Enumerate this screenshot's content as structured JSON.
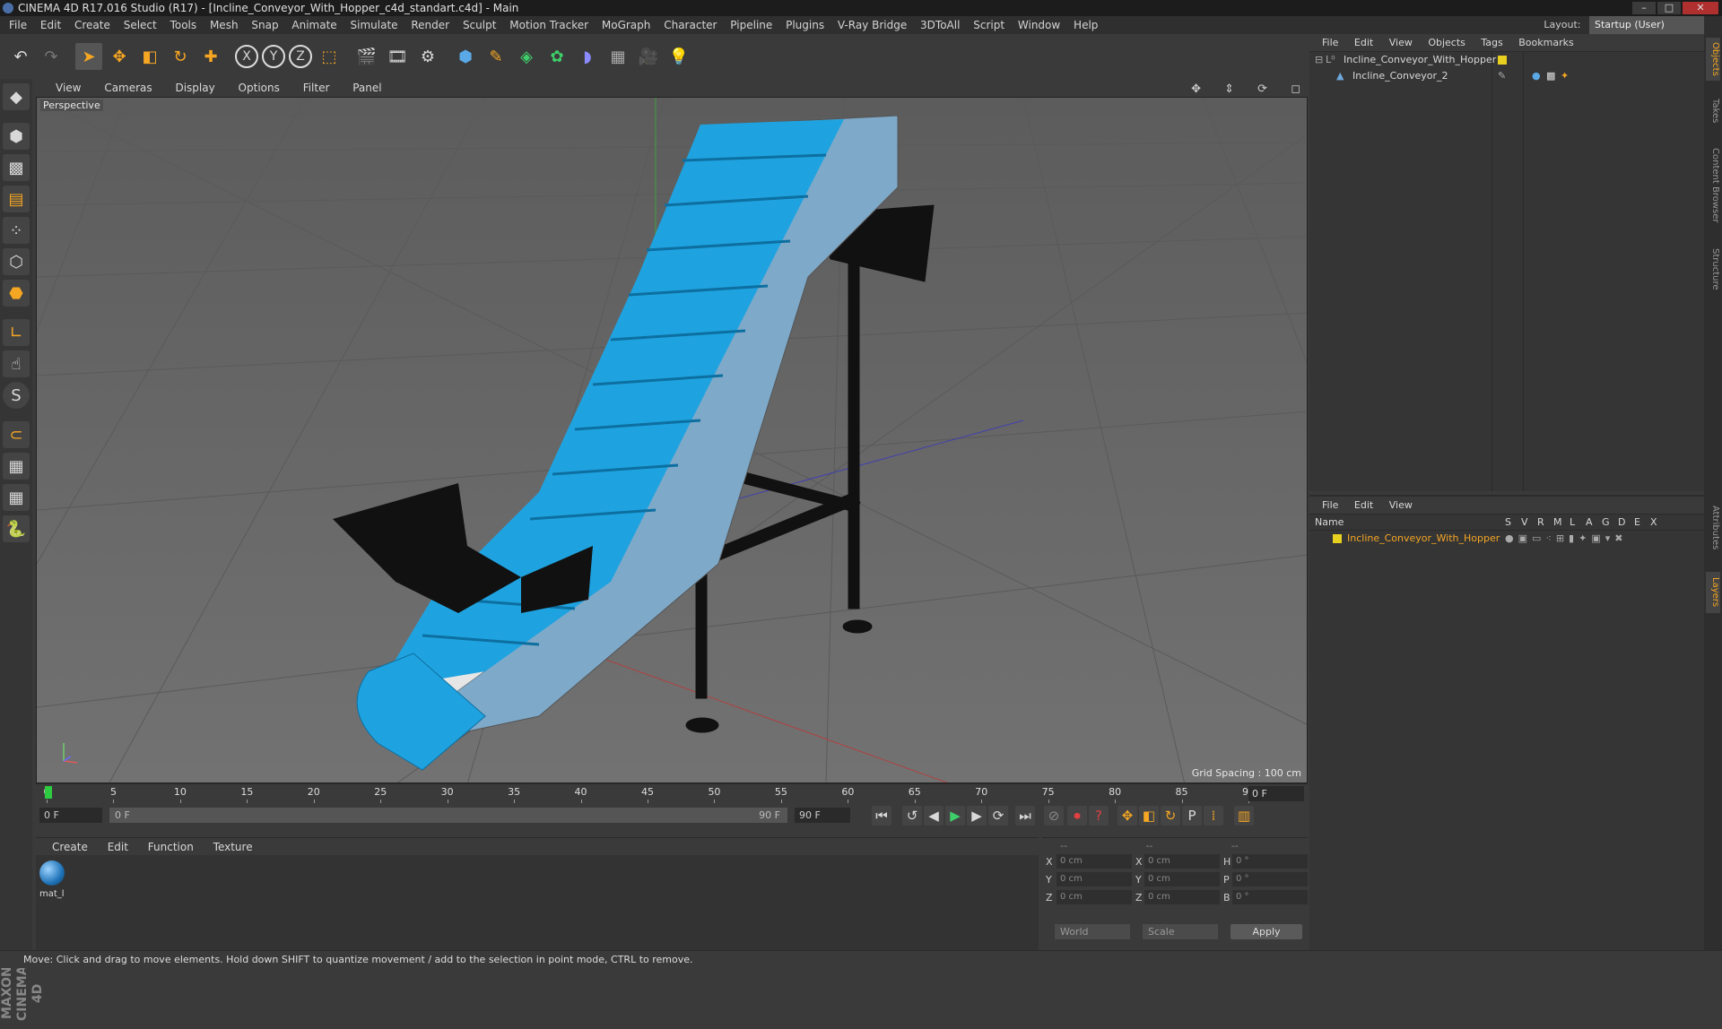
{
  "window": {
    "title": "CINEMA 4D R17.016 Studio (R17) - [Incline_Conveyor_With_Hopper_c4d_standart.c4d] - Main"
  },
  "menubar": {
    "items": [
      "File",
      "Edit",
      "Create",
      "Select",
      "Tools",
      "Mesh",
      "Snap",
      "Animate",
      "Simulate",
      "Render",
      "Sculpt",
      "Motion Tracker",
      "MoGraph",
      "Character",
      "Pipeline",
      "Plugins",
      "V-Ray Bridge",
      "3DToAll",
      "Script",
      "Window",
      "Help"
    ]
  },
  "layout": {
    "label": "Layout:",
    "value": "Startup (User)"
  },
  "viewport": {
    "menu": [
      "View",
      "Cameras",
      "Display",
      "Options",
      "Filter",
      "Panel"
    ],
    "label": "Perspective",
    "grid_spacing": "Grid Spacing : 100 cm"
  },
  "timeline": {
    "ticks": [
      "0",
      "5",
      "10",
      "15",
      "20",
      "25",
      "30",
      "35",
      "40",
      "45",
      "50",
      "55",
      "60",
      "65",
      "70",
      "75",
      "80",
      "85",
      "90"
    ],
    "current_frame": "0 F"
  },
  "transport": {
    "start_frame": "0 F",
    "range_start": "0 F",
    "range_end": "90 F",
    "end_frame": "90 F"
  },
  "materials": {
    "menu": [
      "Create",
      "Edit",
      "Function",
      "Texture"
    ],
    "items": [
      {
        "name": "mat_l"
      }
    ]
  },
  "coords": {
    "header": [
      "--",
      "--",
      "--"
    ],
    "rows": [
      {
        "l1": "X",
        "v1": "0 cm",
        "l2": "X",
        "v2": "0 cm",
        "l3": "H",
        "v3": "0 °"
      },
      {
        "l1": "Y",
        "v1": "0 cm",
        "l2": "Y",
        "v2": "0 cm",
        "l3": "P",
        "v3": "0 °"
      },
      {
        "l1": "Z",
        "v1": "0 cm",
        "l2": "Z",
        "v2": "0 cm",
        "l3": "B",
        "v3": "0 °"
      }
    ],
    "world": "World",
    "scale": "Scale",
    "apply": "Apply"
  },
  "objects_panel": {
    "menu": [
      "File",
      "Edit",
      "View",
      "Objects",
      "Tags",
      "Bookmarks"
    ],
    "items": [
      {
        "name": "Incline_Conveyor_With_Hopper"
      },
      {
        "name": "Incline_Conveyor_2"
      }
    ]
  },
  "layers_panel": {
    "menu": [
      "File",
      "Edit",
      "View"
    ],
    "columns": [
      "Name",
      "S",
      "V",
      "R",
      "M",
      "L",
      "A",
      "G",
      "D",
      "E",
      "X"
    ],
    "items": [
      {
        "name": "Incline_Conveyor_With_Hopper"
      }
    ]
  },
  "side_tabs": [
    "Objects",
    "Takes",
    "Content Browser",
    "Structure",
    "Attributes",
    "Layers"
  ],
  "status": "Move: Click and drag to move elements. Hold down SHIFT to quantize movement / add to the selection in point mode, CTRL to remove.",
  "brand": "MAXON CINEMA 4D",
  "colors": {
    "accent": "#f5a623",
    "belt": "#1fa3e0",
    "frame": "#7ea9c9",
    "viewport_bg": "#6a6a6a"
  }
}
